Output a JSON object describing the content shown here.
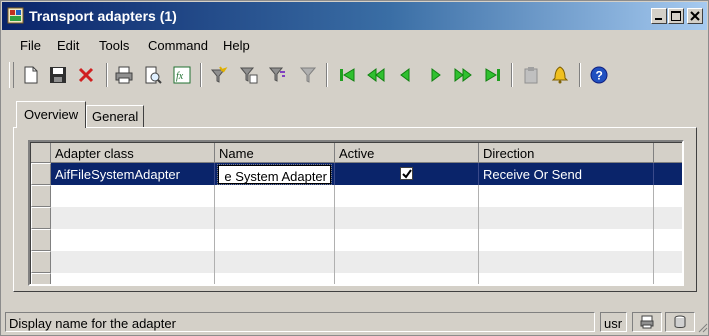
{
  "window": {
    "title": "Transport adapters (1)"
  },
  "menu": [
    "File",
    "Edit",
    "Tools",
    "Command",
    "Help"
  ],
  "toolbar": {
    "icons": [
      "new-icon",
      "save-icon",
      "delete-icon",
      "print-icon",
      "print-preview-icon",
      "export-excel-icon",
      "filter-by-selection-icon",
      "filter-by-form-icon",
      "advanced-filter-icon",
      "remove-filter-icon",
      "first-record-icon",
      "previous-page-icon",
      "previous-record-icon",
      "next-record-icon",
      "next-page-icon",
      "last-record-icon",
      "attachments-icon",
      "alert-icon",
      "help-icon"
    ]
  },
  "tabs": [
    "Overview",
    "General"
  ],
  "grid": {
    "columns": [
      "Adapter class",
      "Name",
      "Active",
      "Direction"
    ],
    "rows": [
      {
        "adapter_class": "AifFileSystemAdapter",
        "name": "e System Adapter",
        "active": true,
        "direction": "Receive Or Send"
      }
    ]
  },
  "status": {
    "message": "Display name for the adapter",
    "user": "usr"
  },
  "colors": {
    "title_start": "#0a246a",
    "title_end": "#a6caf0",
    "selection": "#0a246a",
    "chrome": "#d4d0c8"
  }
}
